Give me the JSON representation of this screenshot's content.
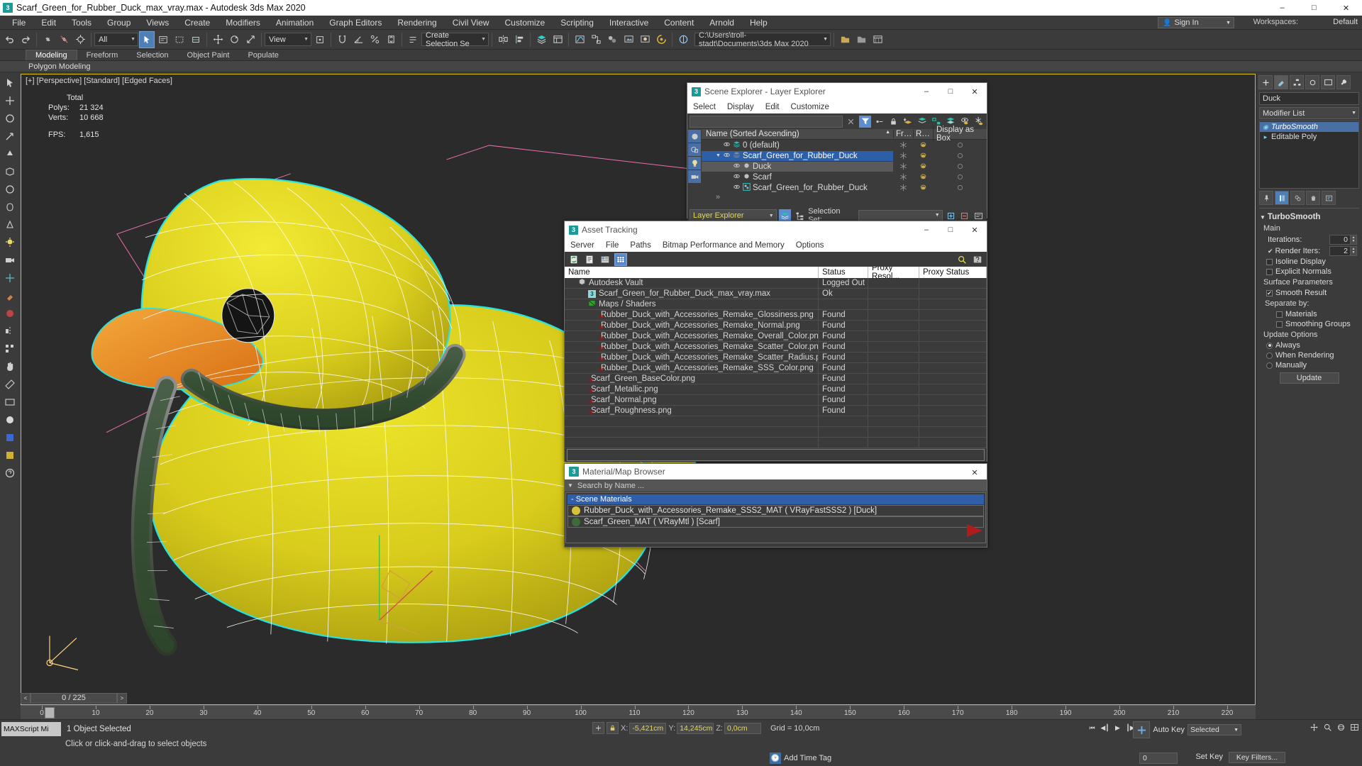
{
  "window": {
    "title": "Scarf_Green_for_Rubber_Duck_max_vray.max - Autodesk 3ds Max 2020",
    "minimize": "–",
    "maximize": "□",
    "close": "✕"
  },
  "menubar": {
    "items": [
      "File",
      "Edit",
      "Tools",
      "Group",
      "Views",
      "Create",
      "Modifiers",
      "Animation",
      "Graph Editors",
      "Rendering",
      "Civil View",
      "Customize",
      "Scripting",
      "Interactive",
      "Content",
      "Arnold",
      "Help"
    ],
    "signin": "Sign In",
    "workspaces_label": "Workspaces:",
    "workspaces_value": "Default"
  },
  "toolbar": {
    "filter_value": "All",
    "view_value": "View",
    "selection_set_placeholder": "Create Selection Se",
    "project_path": "C:\\Users\\troll-stadt\\Documents\\3ds Max 2020"
  },
  "ribbon": {
    "tabs": [
      "Modeling",
      "Freeform",
      "Selection",
      "Object Paint",
      "Populate"
    ],
    "active_tab": "Modeling",
    "subtitle": "Polygon Modeling"
  },
  "viewport": {
    "label": "[+] [Perspective] [Standard] [Edged Faces]",
    "stats": {
      "total_label": "Total",
      "polys_label": "Polys:",
      "polys_value": "21 324",
      "verts_label": "Verts:",
      "verts_value": "10 668",
      "fps_label": "FPS:",
      "fps_value": "1,615"
    }
  },
  "scene_explorer": {
    "title": "Scene Explorer - Layer Explorer",
    "menu": [
      "Select",
      "Display",
      "Edit",
      "Customize"
    ],
    "search_placeholder": "",
    "columns": [
      "Name (Sorted Ascending)",
      "Fr…",
      "R…",
      "Display as Box"
    ],
    "rows": [
      {
        "name": "0 (default)",
        "indent": 1,
        "kind": "layer",
        "selected": false,
        "alt": false
      },
      {
        "name": "Scarf_Green_for_Rubber_Duck",
        "indent": 1,
        "kind": "layer",
        "selected": true,
        "alt": false,
        "expanded": true
      },
      {
        "name": "Duck",
        "indent": 2,
        "kind": "object",
        "selected": false,
        "alt": true
      },
      {
        "name": "Scarf",
        "indent": 2,
        "kind": "object",
        "selected": false,
        "alt": false
      },
      {
        "name": "Scarf_Green_for_Rubber_Duck",
        "indent": 2,
        "kind": "group",
        "selected": false,
        "alt": false
      }
    ],
    "overflow": "»",
    "explorer_combo": "Layer Explorer",
    "selection_set_label": "Selection Set:",
    "selection_set_value": ""
  },
  "asset_tracking": {
    "title": "Asset Tracking",
    "menu": [
      "Server",
      "File",
      "Paths",
      "Bitmap Performance and Memory",
      "Options"
    ],
    "columns": [
      "Name",
      "Status",
      "Proxy Resol...",
      "Proxy Status"
    ],
    "rows": [
      {
        "name": "Autodesk Vault",
        "status": "Logged Out ...",
        "indent": 1,
        "icon": "vault"
      },
      {
        "name": "Scarf_Green_for_Rubber_Duck_max_vray.max",
        "status": "Ok",
        "indent": 2,
        "icon": "max"
      },
      {
        "name": "Maps / Shaders",
        "status": "",
        "indent": 2,
        "icon": "maps"
      },
      {
        "name": "Rubber_Duck_with_Accessories_Remake_Glossiness.png",
        "status": "Found",
        "indent": 3,
        "icon": "png"
      },
      {
        "name": "Rubber_Duck_with_Accessories_Remake_Normal.png",
        "status": "Found",
        "indent": 3,
        "icon": "png"
      },
      {
        "name": "Rubber_Duck_with_Accessories_Remake_Overall_Color.png",
        "status": "Found",
        "indent": 3,
        "icon": "png"
      },
      {
        "name": "Rubber_Duck_with_Accessories_Remake_Scatter_Color.png",
        "status": "Found",
        "indent": 3,
        "icon": "png"
      },
      {
        "name": "Rubber_Duck_with_Accessories_Remake_Scatter_Radius.png",
        "status": "Found",
        "indent": 3,
        "icon": "png"
      },
      {
        "name": "Rubber_Duck_with_Accessories_Remake_SSS_Color.png",
        "status": "Found",
        "indent": 3,
        "icon": "png"
      },
      {
        "name": "Scarf_Green_BaseColor.png",
        "status": "Found",
        "indent": 2,
        "icon": "png"
      },
      {
        "name": "Scarf_Metallic.png",
        "status": "Found",
        "indent": 2,
        "icon": "png"
      },
      {
        "name": "Scarf_Normal.png",
        "status": "Found",
        "indent": 2,
        "icon": "png"
      },
      {
        "name": "Scarf_Roughness.png",
        "status": "Found",
        "indent": 2,
        "icon": "png"
      }
    ]
  },
  "material_browser": {
    "title": "Material/Map Browser",
    "search_placeholder": "Search by Name ...",
    "group_label": "- Scene Materials",
    "items": [
      {
        "name": "Rubber_Duck_with_Accessories_Remake_SSS2_MAT  ( VRayFastSSS2 )  [Duck]",
        "color": "#d8c23a"
      },
      {
        "name": "Scarf_Green_MAT  ( VRayMtl )  [Scarf]",
        "color": "#3f6b3a"
      }
    ]
  },
  "command_panel": {
    "object_name": "Duck",
    "modifier_list_label": "Modifier List",
    "stack": [
      {
        "label": "TurboSmooth",
        "selected": true,
        "italic": true
      },
      {
        "label": "Editable Poly",
        "selected": false,
        "italic": false
      }
    ],
    "rollout_title": "TurboSmooth",
    "main_label": "Main",
    "iterations_label": "Iterations:",
    "iterations_value": "0",
    "render_iters_label": "Render Iters:",
    "render_iters_value": "2",
    "isoline_label": "Isoline Display",
    "isoline_checked": false,
    "explicit_normals_label": "Explicit Normals",
    "explicit_normals_checked": false,
    "surface_params_label": "Surface Parameters",
    "smooth_result_label": "Smooth Result",
    "smooth_result_checked": true,
    "separate_by_label": "Separate by:",
    "materials_label": "Materials",
    "materials_checked": false,
    "smoothing_groups_label": "Smoothing Groups",
    "smoothing_groups_checked": false,
    "update_options_label": "Update Options",
    "update_mode": "Always",
    "update_modes": [
      "Always",
      "When Rendering",
      "Manually"
    ],
    "update_button": "Update"
  },
  "timeline": {
    "frame_field": "0 / 225",
    "prev": "<",
    "next": ">",
    "ticks": [
      0,
      10,
      20,
      30,
      40,
      50,
      60,
      70,
      80,
      90,
      100,
      110,
      120,
      130,
      140,
      150,
      160,
      170,
      180,
      190,
      200,
      210,
      220
    ]
  },
  "statusbar": {
    "maxscript": "MAXScript Mi",
    "object_selected": "1 Object Selected",
    "hint": "Click or click-and-drag to select objects",
    "x_label": "X:",
    "x_value": "-5,421cm",
    "y_label": "Y:",
    "y_value": "14,245cm",
    "z_label": "Z:",
    "z_value": "0,0cm",
    "grid": "Grid = 10,0cm",
    "add_time_tag": "Add Time Tag",
    "auto_key": "Auto Key",
    "set_key": "Set Key",
    "key_filters": "Key Filters...",
    "selected_combo": "Selected",
    "spinner_value": "0"
  },
  "colors": {
    "accent_blue": "#2d5fa8",
    "highlight_blue": "#5b8dd0",
    "duck_yellow": "#d4c81d",
    "beak_orange": "#e08a25",
    "selection_cyan": "#24e4e4",
    "viewport_border": "#e0c200",
    "gizmo_pink": "#ff77bb"
  }
}
